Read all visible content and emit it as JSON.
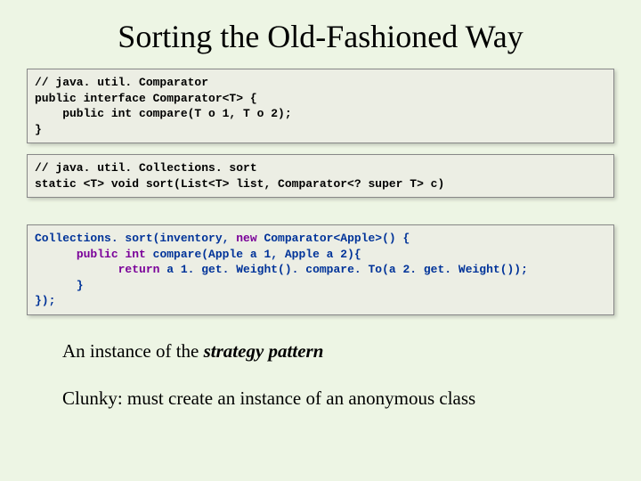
{
  "title": "Sorting the Old-Fashioned Way",
  "code1": "// java. util. Comparator\npublic interface Comparator<T> {\n    public int compare(T o 1, T o 2);\n}",
  "code2": "// java. util. Collections. sort\nstatic <T> void sort(List<T> list, Comparator<? super T> c)",
  "code3_parts": {
    "l1a": "Collections. sort(inventory, ",
    "l1b": "new",
    "l1c": " Comparator<Apple>() {",
    "l2a": "      ",
    "l2b": "public",
    "l2c": " ",
    "l2d": "int",
    "l2e": " compare(Apple a 1, Apple a 2){",
    "l3a": "            ",
    "l3b": "return",
    "l3c": " a 1. get. Weight(). compare. To(a 2. get. Weight());",
    "l4": "      }",
    "l5": "});"
  },
  "point1_a": "An instance of the ",
  "point1_b": "strategy pattern",
  "point2": "Clunky: must create an instance of an anonymous class"
}
